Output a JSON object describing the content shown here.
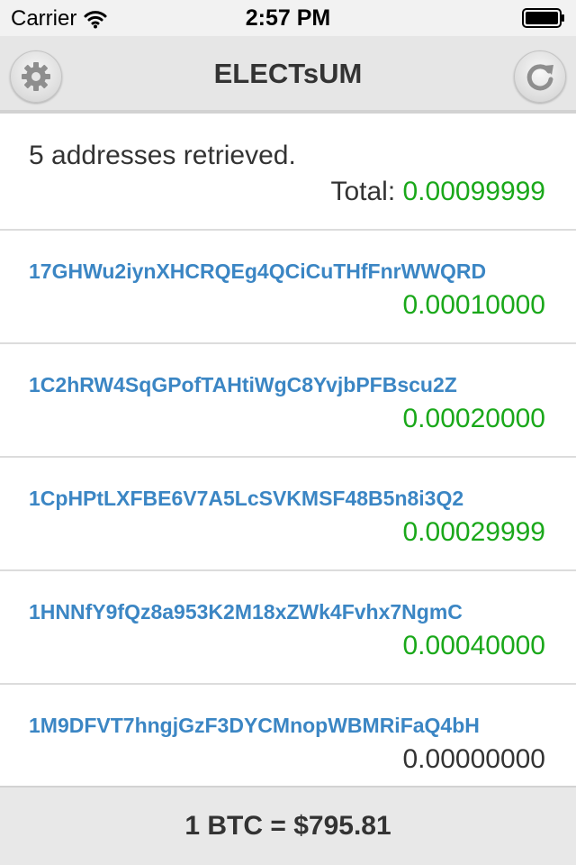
{
  "status_bar": {
    "carrier": "Carrier",
    "time": "2:57 PM"
  },
  "nav": {
    "title": "ELECTsUM",
    "left_icon": "gear-icon",
    "right_icon": "refresh-icon"
  },
  "summary": {
    "count_text": "5 addresses retrieved.",
    "total_label": "Total: ",
    "total_value": "0.00099999"
  },
  "addresses": [
    {
      "address": "17GHWu2iynXHCRQEg4QCiCuTHfFnrWWQRD",
      "amount": "0.00010000"
    },
    {
      "address": "1C2hRW4SqGPofTAHtiWgC8YvjbPFBscu2Z",
      "amount": "0.00020000"
    },
    {
      "address": "1CpHPtLXFBE6V7A5LcSVKMSF48B5n8i3Q2",
      "amount": "0.00029999"
    },
    {
      "address": "1HNNfY9fQz8a953K2M18xZWk4Fvhx7NgmC",
      "amount": "0.00040000"
    },
    {
      "address": "1M9DFVT7hngjGzF3DYCMnopWBMRiFaQ4bH",
      "amount": "0.00000000"
    }
  ],
  "footer": {
    "rate_text": "1 BTC = $795.81"
  },
  "colors": {
    "address_link": "#3b86c4",
    "positive_amount": "#1aa81a",
    "zero_amount": "#333333"
  }
}
